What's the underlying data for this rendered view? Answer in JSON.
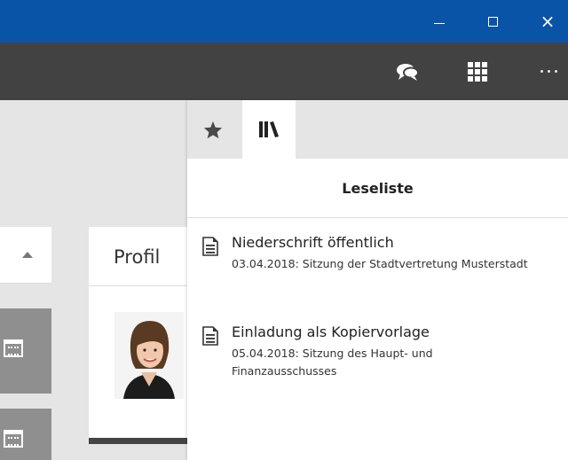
{
  "window": {
    "minimize_glyph": "",
    "close_glyph": "×"
  },
  "toolbar": {
    "icons": [
      "chat-icon",
      "apps-grid-icon",
      "more-icon"
    ]
  },
  "profile_card": {
    "title": "Profil"
  },
  "panel": {
    "tabs": [
      {
        "icon": "star-icon",
        "name": "favorites"
      },
      {
        "icon": "library-icon",
        "name": "library"
      }
    ],
    "heading": "Leseliste",
    "items": [
      {
        "title": "Niederschrift öffentlich",
        "subtitle": "03.04.2018: Sitzung der Stadtvertretung Musterstadt"
      },
      {
        "title": "Einladung als Kopiervorlage",
        "subtitle": "05.04.2018: Sitzung des Haupt- und Finanzausschusses"
      }
    ]
  },
  "colors": {
    "titlebar": "#0a54a8",
    "toolbar": "#424242",
    "background": "#e5e5e5"
  }
}
